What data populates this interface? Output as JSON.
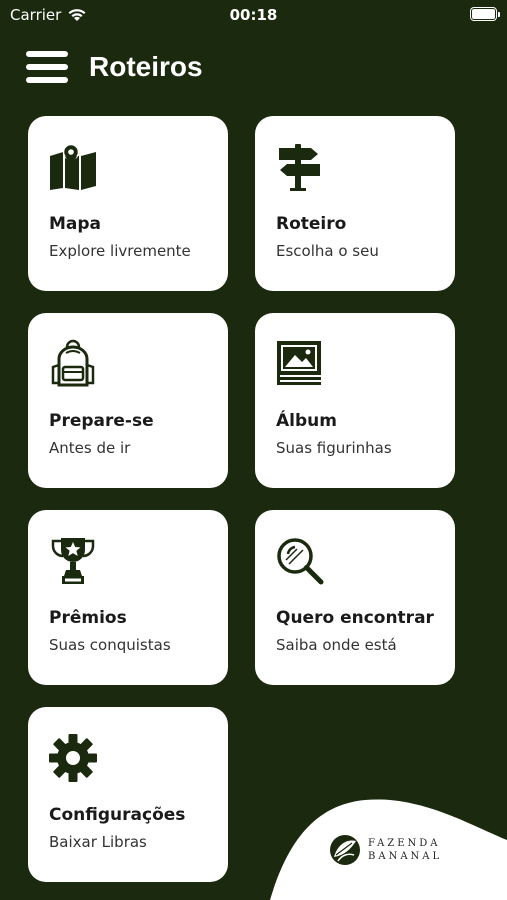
{
  "status_bar": {
    "carrier": "Carrier",
    "time": "00:18"
  },
  "header": {
    "title": "Roteiros"
  },
  "cards": [
    {
      "label": "Mapa",
      "sublabel": "Explore livremente",
      "icon": "map-icon"
    },
    {
      "label": "Roteiro",
      "sublabel": "Escolha o seu",
      "icon": "signpost-icon"
    },
    {
      "label": "Prepare-se",
      "sublabel": "Antes de ir",
      "icon": "backpack-icon"
    },
    {
      "label": "Álbum",
      "sublabel": "Suas figurinhas",
      "icon": "album-icon"
    },
    {
      "label": "Prêmios",
      "sublabel": "Suas conquistas",
      "icon": "trophy-icon"
    },
    {
      "label": "Quero encontrar",
      "sublabel": "Saiba onde está",
      "icon": "magnifier-icon"
    },
    {
      "label": "Configurações",
      "sublabel": "Baixar Libras",
      "icon": "gear-icon"
    }
  ],
  "footer": {
    "logo_line1": "FAZENDA",
    "logo_line2": "BANANAL"
  },
  "colors": {
    "background": "#1b2a0f",
    "card": "#ffffff",
    "icon": "#1b2a0f"
  }
}
